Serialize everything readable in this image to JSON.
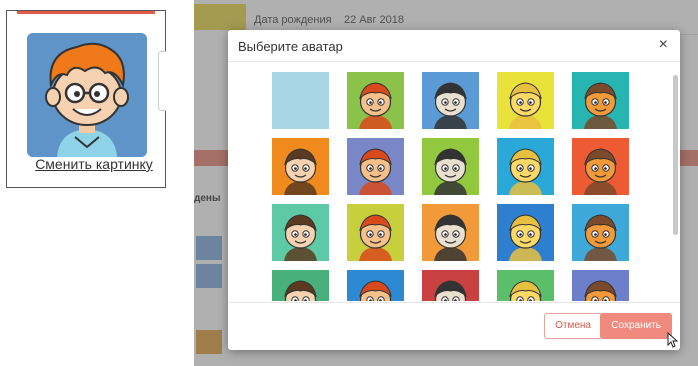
{
  "profile": {
    "change_picture_label": "Сменить картинку",
    "avatar_bg": "#5f94c8"
  },
  "background": {
    "birth_date_label": "Дата рождения",
    "birth_date_value": "22 Авг 2018",
    "side_heading": "дены"
  },
  "modal": {
    "title": "Выберите аватар",
    "close_glyph": "×",
    "avatars": [
      {
        "icon": "blank-avatar-icon",
        "bg": "#a9d6e5"
      },
      {
        "icon": "girl-pigtails-icon",
        "bg": "#8bc34a"
      },
      {
        "icon": "raccoon-icon",
        "bg": "#5b9bd5"
      },
      {
        "icon": "blonde-girl-icon",
        "bg": "#e8e23a"
      },
      {
        "icon": "orange-fox-icon",
        "bg": "#26b5b0"
      },
      {
        "icon": "gopher-icon",
        "bg": "#f08a1c"
      },
      {
        "icon": "boy-cap-icon",
        "bg": "#7a87c7"
      },
      {
        "icon": "yellow-chick-icon",
        "bg": "#92c83e"
      },
      {
        "icon": "bearded-man-icon",
        "bg": "#2aa9d8"
      },
      {
        "icon": "dark-hair-girl-icon",
        "bg": "#ee5a34"
      },
      {
        "icon": "girl-bow-icon",
        "bg": "#5ec9a5"
      },
      {
        "icon": "cowboy-hat-icon",
        "bg": "#c8cf3c"
      },
      {
        "icon": "red-riding-hood-icon",
        "bg": "#f29a3a"
      },
      {
        "icon": "sailor-hat-icon",
        "bg": "#2e7fcf"
      },
      {
        "icon": "plant-creature-icon",
        "bg": "#3ea9d8"
      },
      {
        "icon": "bear-icon",
        "bg": "#48b07a"
      },
      {
        "icon": "yellow-creature-icon",
        "bg": "#2d89d1"
      },
      {
        "icon": "robot-head-icon",
        "bg": "#c94040"
      },
      {
        "icon": "tiger-cub-icon",
        "bg": "#5bbf6a"
      },
      {
        "icon": "wizard-icon",
        "bg": "#6d7fcb"
      }
    ],
    "cancel_label": "Отмена",
    "save_label": "Сохранить"
  }
}
